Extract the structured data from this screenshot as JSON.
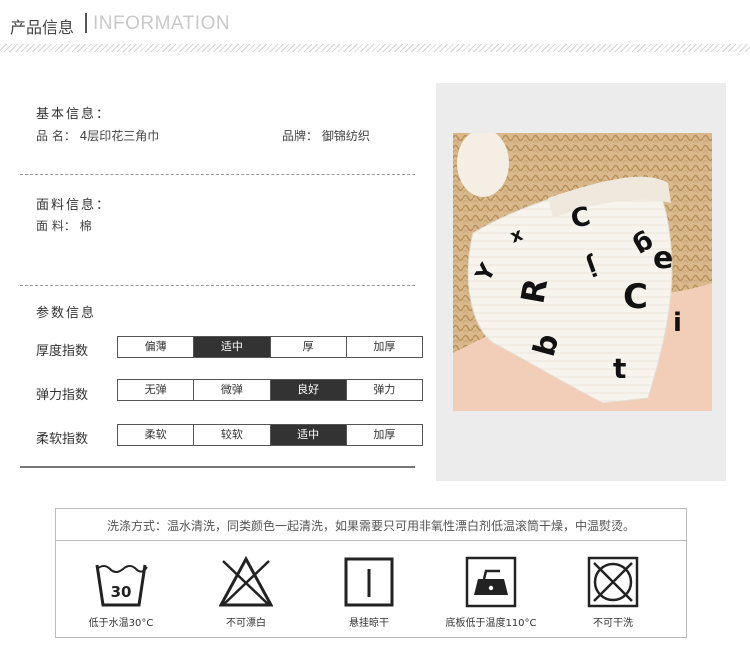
{
  "header": {
    "title_cn": "产品信息",
    "title_en": "INFORMATION"
  },
  "basic": {
    "title": "基本信息：",
    "name_label": "品 名：",
    "name_value": "4层印花三角巾",
    "brand_label": "品牌：",
    "brand_value": "御锦纺织"
  },
  "fabric": {
    "title": "面料信息：",
    "label": "面 料：",
    "value": "棉"
  },
  "params": {
    "title": "参数信息",
    "rows": [
      {
        "label": "厚度指数",
        "options": [
          "偏薄",
          "适中",
          "厚",
          "加厚"
        ],
        "selected": 1
      },
      {
        "label": "弹力指数",
        "options": [
          "无弹",
          "微弹",
          "良好",
          "弹力"
        ],
        "selected": 2
      },
      {
        "label": "柔软指数",
        "options": [
          "柔软",
          "较软",
          "适中",
          "加厚"
        ],
        "selected": 2
      }
    ]
  },
  "care": {
    "text": "洗涤方式：温水清洗，同类颜色一起清洗，如果需要只可用非氧性漂白剂低温滚筒干燥，中温熨烫。",
    "wash_temp": "30",
    "items": [
      {
        "icon": "wash-30-icon",
        "label": "低于水温30°C"
      },
      {
        "icon": "no-bleach-icon",
        "label": "不可漂白"
      },
      {
        "icon": "hang-dry-icon",
        "label": "悬挂晾干"
      },
      {
        "icon": "iron-low-icon",
        "label": "底板低于温度110°C"
      },
      {
        "icon": "no-tumble-dry-icon",
        "label": "不可干洗"
      }
    ]
  },
  "colors": {
    "selected_bg": "#333333",
    "photo_bg": "#f2cdb8",
    "box_bg": "#ececec"
  }
}
